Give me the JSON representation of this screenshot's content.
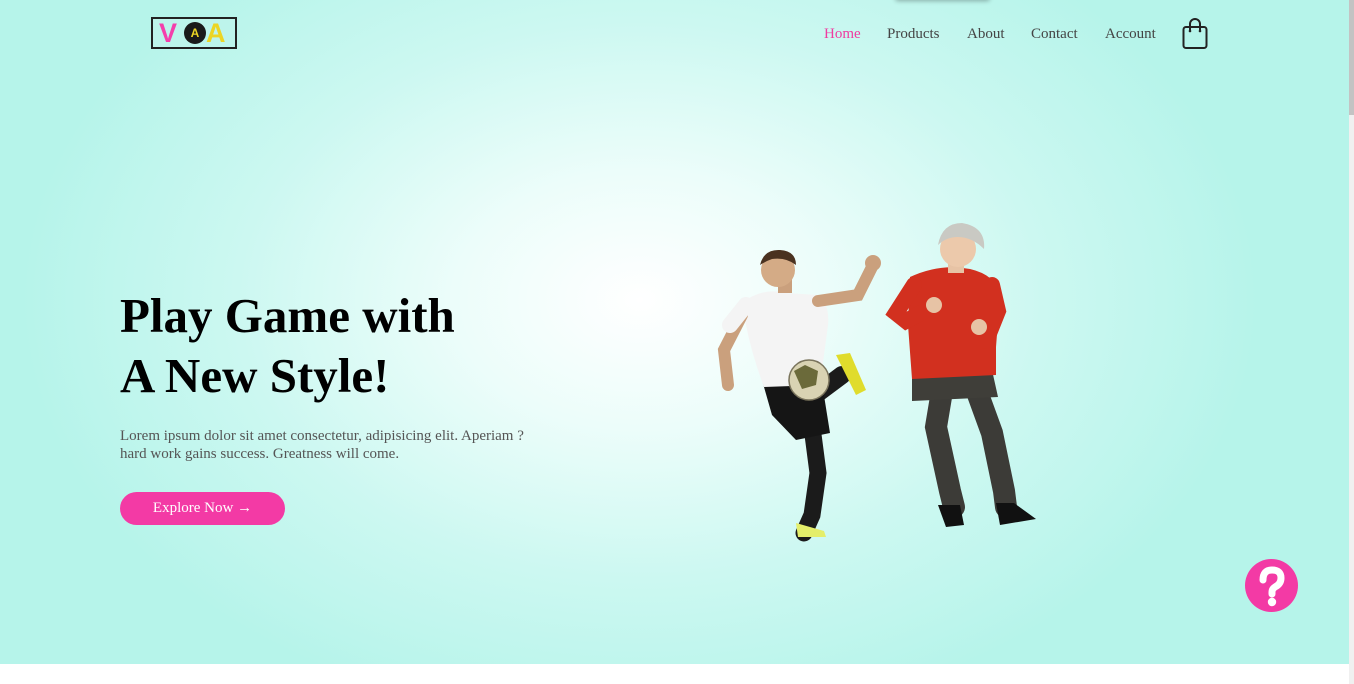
{
  "logo": {
    "letter_left": "V",
    "letter_middle": "A",
    "letter_right": "A",
    "icon": "voa-logo"
  },
  "nav": {
    "items": [
      {
        "label": "Home",
        "active": true
      },
      {
        "label": "Products",
        "active": false
      },
      {
        "label": "About",
        "active": false
      },
      {
        "label": "Contact",
        "active": false
      },
      {
        "label": "Account",
        "active": false
      }
    ],
    "cart_icon": "shopping-bag-icon"
  },
  "hero": {
    "title_line1": "Play Game with",
    "title_line2": "A New Style!",
    "description_line1": "Lorem ipsum dolor sit amet consectetur, adipisicing elit. Aperiam ?",
    "description_line2": "hard work gains success. Greatness will come.",
    "cta_label": "Explore Now →",
    "image": "two-football-players-photo"
  },
  "help_button": {
    "icon": "question-mark-icon"
  },
  "colors": {
    "accent": "#f33aa5",
    "nav_active": "#ef3ba0",
    "background": "#b6f4ea",
    "text": "#000000"
  }
}
